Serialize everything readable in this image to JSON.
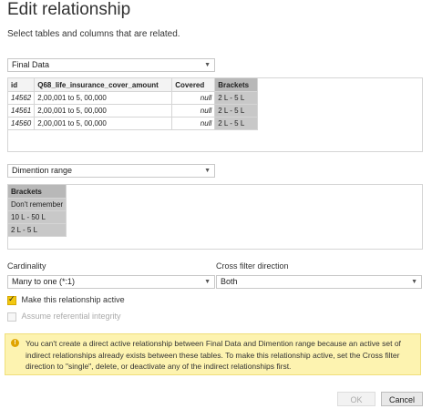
{
  "dialog": {
    "title": "Edit relationship",
    "subtitle": "Select tables and columns that are related."
  },
  "table1": {
    "selected": "Final Data",
    "columns": [
      "id",
      "Q68_life_insurance_cover_amount",
      "Covered",
      "Brackets"
    ],
    "selected_column": "Brackets",
    "rows": [
      [
        "14562",
        "2,00,001 to 5, 00,000",
        "null",
        "2 L - 5 L"
      ],
      [
        "14561",
        "2,00,001 to 5, 00,000",
        "null",
        "2 L - 5 L"
      ],
      [
        "14560",
        "2,00,001 to 5, 00,000",
        "null",
        "2 L - 5 L"
      ]
    ]
  },
  "table2": {
    "selected": "Dimention range",
    "columns": [
      "Brackets"
    ],
    "rows": [
      [
        "Don't remember"
      ],
      [
        "10 L - 50 L"
      ],
      [
        "2 L - 5 L"
      ]
    ]
  },
  "cardinality": {
    "label": "Cardinality",
    "selected": "Many to one (*:1)"
  },
  "cross_filter": {
    "label": "Cross filter direction",
    "selected": "Both"
  },
  "options": {
    "active_label": "Make this relationship active",
    "active_checked": true,
    "referential_label": "Assume referential integrity",
    "referential_checked": false
  },
  "warning": {
    "icon": "!",
    "text": "You can't create a direct active relationship between Final Data and Dimention range because an active set of indirect relationships already exists between these tables. To make this relationship active, set the Cross filter direction to \"single\", delete, or deactivate any of the indirect relationships first."
  },
  "buttons": {
    "ok": "OK",
    "cancel": "Cancel"
  },
  "icons": {
    "dropdown": "chevron-down-icon",
    "warning": "warning-icon"
  },
  "colors": {
    "warning_bg": "#fdf3b0",
    "checkbox_accent": "#f2c811",
    "selected_column": "#c8c8c8"
  }
}
